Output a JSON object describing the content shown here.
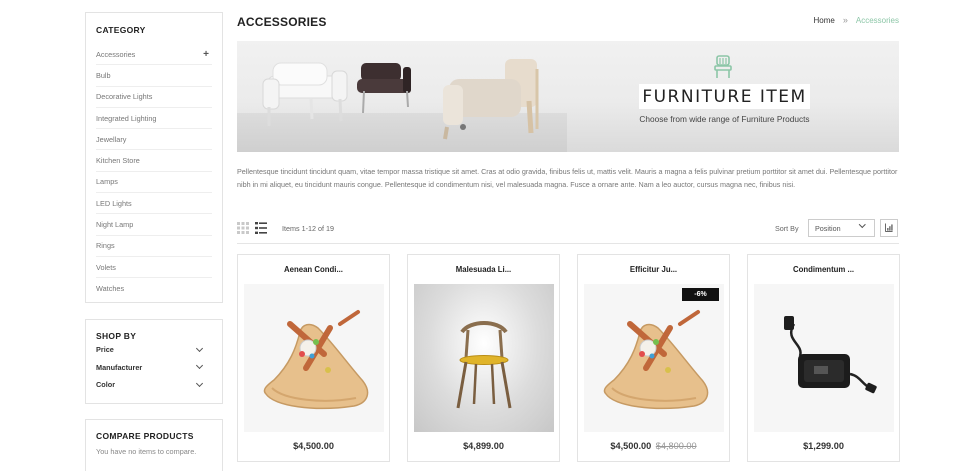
{
  "sidebar": {
    "category": {
      "title": "CATEGORY",
      "items": [
        {
          "label": "Accessories",
          "expand": "+"
        },
        {
          "label": "Bulb"
        },
        {
          "label": "Decorative Lights"
        },
        {
          "label": "Integrated Lighting"
        },
        {
          "label": "Jewellary"
        },
        {
          "label": "Kitchen Store"
        },
        {
          "label": "Lamps"
        },
        {
          "label": "LED Lights"
        },
        {
          "label": "Night Lamp"
        },
        {
          "label": "Rings"
        },
        {
          "label": "Volets"
        },
        {
          "label": "Watches"
        }
      ]
    },
    "shop_by": {
      "title": "SHOP BY",
      "filters": [
        "Price",
        "Manufacturer",
        "Color"
      ]
    },
    "compare": {
      "title": "COMPARE PRODUCTS",
      "text": "You have no items to compare."
    }
  },
  "header": {
    "title": "ACCESSORIES",
    "breadcrumb": {
      "home": "Home",
      "separator": "»",
      "current": "Accessories"
    }
  },
  "banner": {
    "heading": "FURNITURE ITEM",
    "subheading": "Choose from wide range of Furniture Products",
    "accent_color": "#8cc6a7"
  },
  "description": "Pellentesque tincidunt tincidunt quam, vitae tempor massa tristique sit amet. Cras at odio gravida, finibus felis ut, mattis velit. Mauris a magna a felis pulvinar pretium porttitor sit amet dui. Pellentesque porttitor nibh in mi aliquet, eu tincidunt mauris congue. Pellentesque id condimentum nisi, vel malesuada magna. Fusce a ornare ante. Nam a leo auctor, cursus magna nec, finibus nisi.",
  "toolbar": {
    "view_modes": [
      "grid-view-icon",
      "list-view-icon"
    ],
    "items_count": "Items 1-12 of 19",
    "sort_label": "Sort By",
    "sort_value": "Position"
  },
  "products": [
    {
      "name": "Aenean Condi...",
      "price": "$4,500.00",
      "image": "sandal"
    },
    {
      "name": "Malesuada Li...",
      "price": "$4,899.00",
      "image": "chair"
    },
    {
      "name": "Efficitur Ju...",
      "price": "$4,500.00",
      "old_price": "$4,800.00",
      "badge": "-6%",
      "image": "sandal"
    },
    {
      "name": "Condimentum ...",
      "price": "$1,299.00",
      "image": "power-adapter"
    }
  ]
}
